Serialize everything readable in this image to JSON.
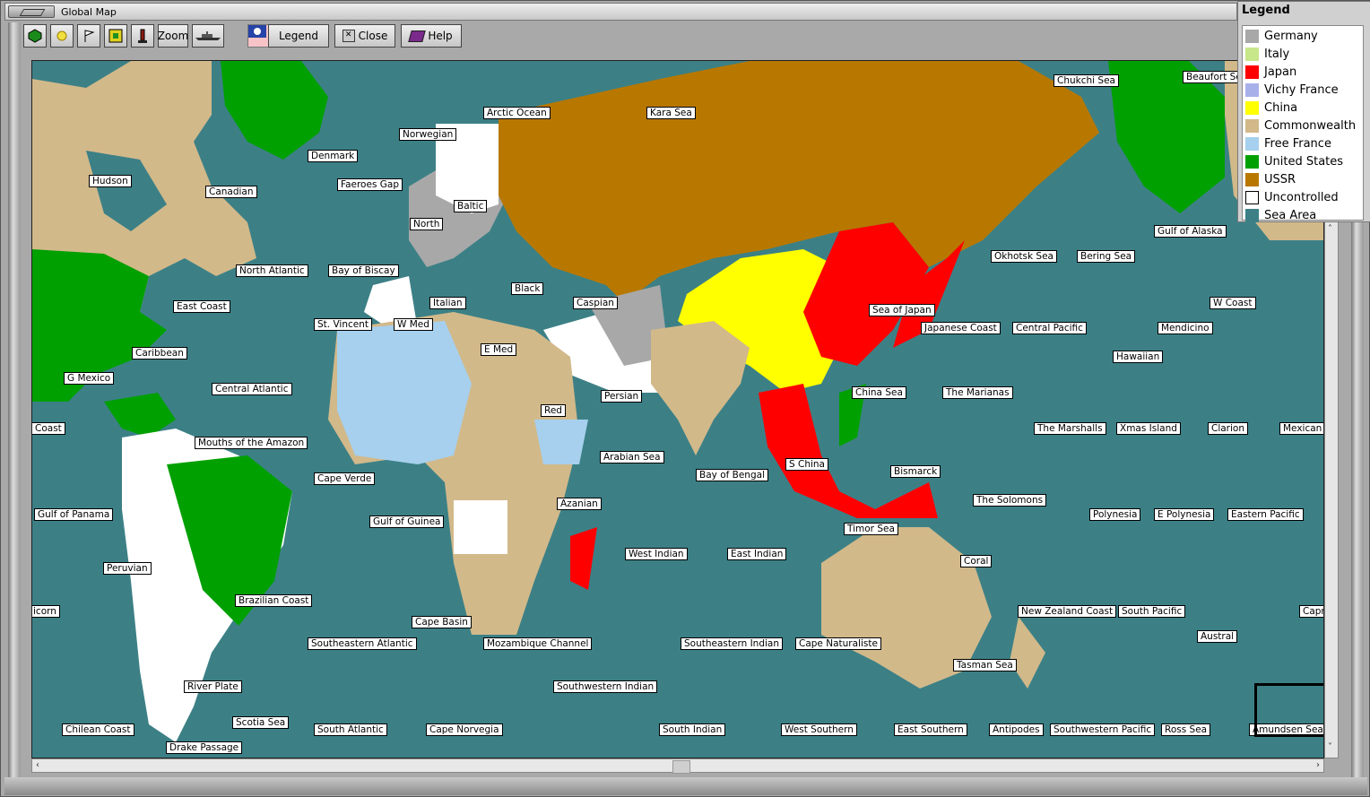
{
  "window": {
    "title": "Global Map"
  },
  "toolbar": {
    "zoom_label": "Zoom",
    "legend_label": "Legend",
    "close_label": "Close",
    "help_label": "Help"
  },
  "legend": {
    "title": "Legend",
    "items": [
      {
        "label": "Germany",
        "color": "#a8a8a8"
      },
      {
        "label": "Italy",
        "color": "#c8e68a"
      },
      {
        "label": "Japan",
        "color": "#ff0000"
      },
      {
        "label": "Vichy France",
        "color": "#a8b0ea"
      },
      {
        "label": "China",
        "color": "#ffff00"
      },
      {
        "label": "Commonwealth",
        "color": "#d2b98a"
      },
      {
        "label": "Free France",
        "color": "#a6d0ee"
      },
      {
        "label": "United States",
        "color": "#00a000"
      },
      {
        "label": "USSR",
        "color": "#b87800"
      },
      {
        "label": "Uncontrolled",
        "color": "#ffffff"
      },
      {
        "label": "Sea Area",
        "color": "#3c8086"
      }
    ]
  },
  "map": {
    "labels": [
      "Arctic Ocean",
      "Kara Sea",
      "Chukchi Sea",
      "Beaufort Sea",
      "Norwegian",
      "Denmark",
      "Hudson",
      "Canadian",
      "Faeroes Gap",
      "Baltic",
      "North",
      "Gulf of Alaska",
      "Okhotsk Sea",
      "Bering Sea",
      "North Atlantic",
      "Bay of Biscay",
      "Italian",
      "Black",
      "Caspian",
      "Sea of Japan",
      "W Coast",
      "East Coast",
      "St. Vincent",
      "W Med",
      "E Med",
      "Japanese Coast",
      "Central Pacific",
      "Mendicino",
      "Caribbean",
      "Hawaiian",
      "G Mexico",
      "Central Atlantic",
      "Persian",
      "China Sea",
      "The Marianas",
      "Coast",
      "Red",
      "The Marshalls",
      "Xmas Island",
      "Clarion",
      "Mexican C",
      "Mouths of the Amazon",
      "Arabian Sea",
      "S China",
      "Bismarck",
      "Cape Verde",
      "Bay of Bengal",
      "The Solomons",
      "Gulf of Panama",
      "Gulf of Guinea",
      "Azanian",
      "Polynesia",
      "E Polynesia",
      "Eastern Pacific",
      "Timor Sea",
      "West Indian",
      "East Indian",
      "Coral",
      "Peruvian",
      "Brazilian Coast",
      "icorn",
      "New Zealand Coast",
      "South Pacific",
      "Capr",
      "Cape Basin",
      "Austral",
      "Southeastern Atlantic",
      "Mozambique Channel",
      "Southeastern Indian",
      "Cape Naturaliste",
      "Tasman Sea",
      "River Plate",
      "Southwestern Indian",
      "Scotia Sea",
      "Chilean Coast",
      "South Atlantic",
      "Cape Norvegia",
      "South Indian",
      "West Southern",
      "East Southern",
      "Antipodes",
      "Southwestern Pacific",
      "Ross Sea",
      "Amundsen Sea",
      "Drake Passage"
    ]
  }
}
